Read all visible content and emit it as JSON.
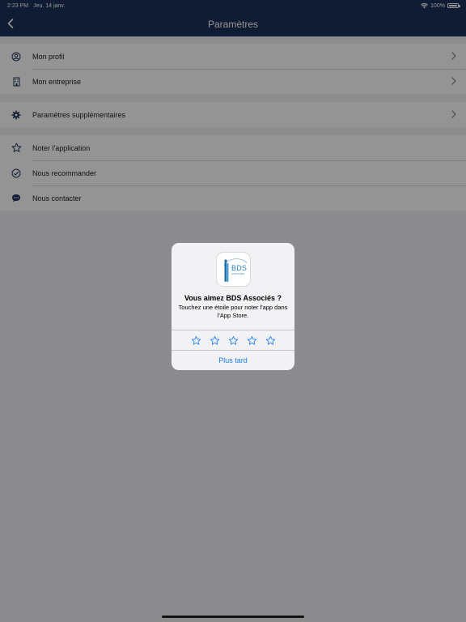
{
  "status_bar": {
    "time": "2:23 PM",
    "date": "Jeu. 14 janv.",
    "battery": "100%",
    "icons": [
      "wifi-icon",
      "battery-icon"
    ]
  },
  "nav": {
    "title": "Paramètres",
    "back_icon": "chevron-left-icon"
  },
  "settings": {
    "group1": [
      {
        "label": "Mon profil",
        "icon": "person-circle-icon"
      },
      {
        "label": "Mon entreprise",
        "icon": "building-icon"
      }
    ],
    "group2": [
      {
        "label": "Paramètres supplémentaires",
        "icon": "gear-icon"
      }
    ],
    "group3": [
      {
        "label": "Noter l'application",
        "icon": "star-icon"
      },
      {
        "label": "Nous recommander",
        "icon": "checkmark-circle-icon"
      },
      {
        "label": "Nous contacter",
        "icon": "chat-bubble-icon"
      }
    ]
  },
  "rating_alert": {
    "app_logo": {
      "word": "BDS",
      "sub": "ASSOCIÉS"
    },
    "title": "Vous aimez BDS Associés ?",
    "message": "Touchez une étoile pour noter l'app dans l'App Store.",
    "star_count": 5,
    "later_label": "Plus tard"
  },
  "colors": {
    "nav_bg": "#1c3158",
    "icon": "#1c3158",
    "accent": "#1a7cf0"
  }
}
